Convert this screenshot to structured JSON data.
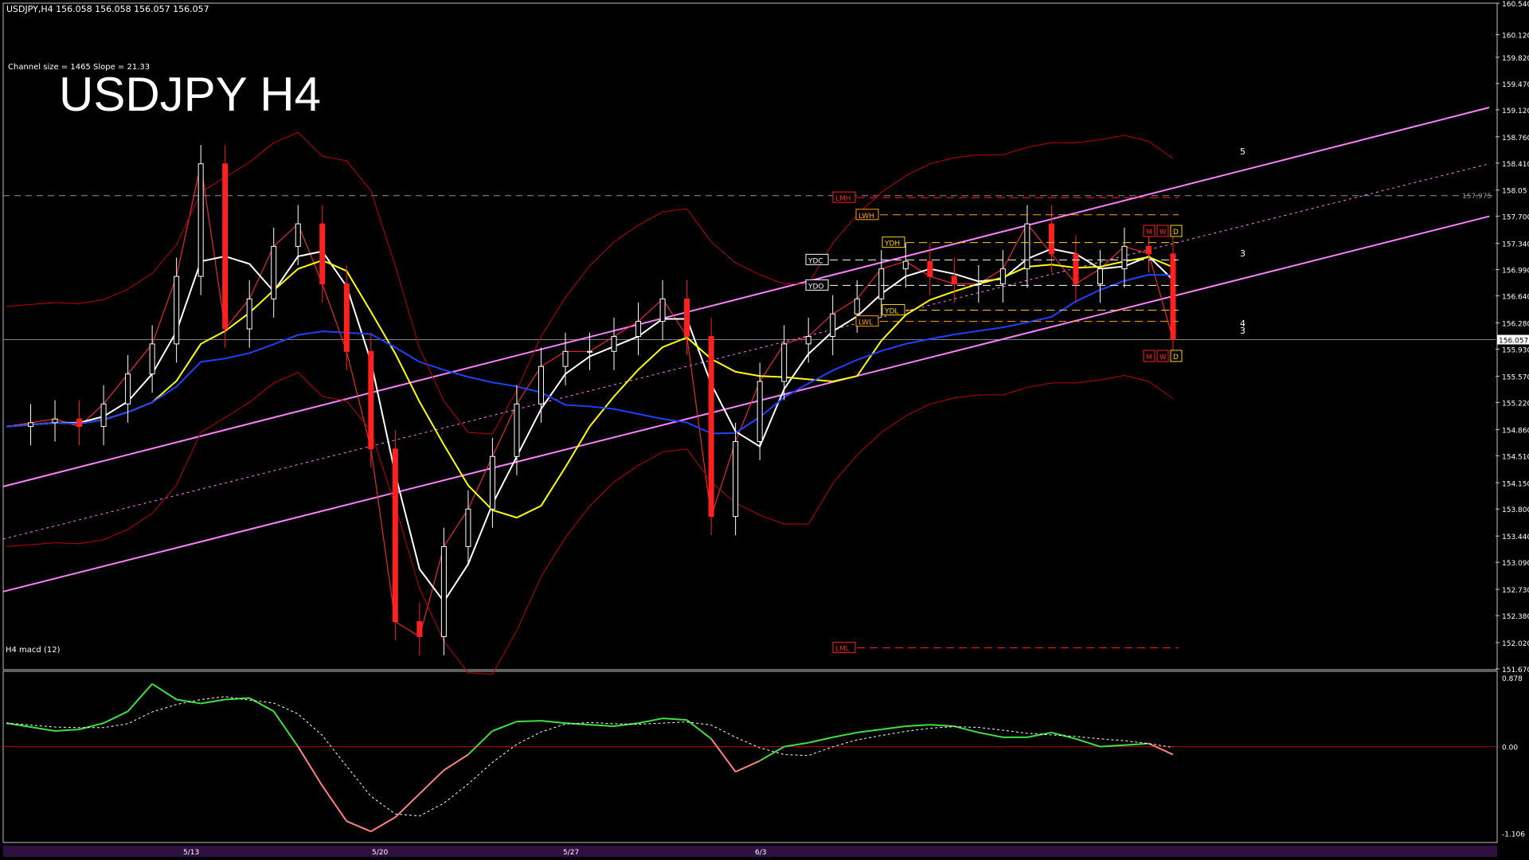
{
  "header": {
    "symbol_line": "USDJPY,H4  156.058 156.058 156.057 156.057",
    "channel_info": "Channel size = 1465 Slope = 21.33",
    "big_title": "USDJPY H4",
    "macd_title": "H4  macd (12)"
  },
  "colors": {
    "background": "#000000",
    "bull_candle": "#ffffff",
    "bear_candle": "#ff2020",
    "channel": "#ff80ff",
    "ma_white": "#ffffff",
    "ma_yellow": "#ffff00",
    "ma_blue": "#2040ff",
    "bollinger": "#c00000",
    "rsi_green": "#20c020",
    "macd_line": "#40e040",
    "macd_line_neg": "#ff8080",
    "macd_signal": "#ffffff",
    "zero_line": "#c00000",
    "axis_text": "#ffffff"
  },
  "chart_data": [
    {
      "type": "line",
      "title": "USDJPY H4",
      "price_scale": [
        "160.540",
        "160.120",
        "159.820",
        "159.470",
        "159.120",
        "158.760",
        "158.410",
        "158.05",
        "157.700",
        "157.340",
        "156.990",
        "156.640",
        "156.280",
        "155.930",
        "155.570",
        "155.220",
        "154.860",
        "154.510",
        "154.150",
        "153.800",
        "153.440",
        "153.090",
        "152.730",
        "152.380",
        "152.020",
        "151.670"
      ],
      "ylim": [
        151.67,
        160.54
      ],
      "current_price": "156.057",
      "dashed_level_label": "157.975",
      "x_date_labels": [
        "5/13",
        "5/20",
        "5/27",
        "6/3"
      ],
      "level_labels": [
        "LMH",
        "LWH",
        "YDH",
        "YDC",
        "YDO",
        "YDL",
        "LWL",
        "LML"
      ],
      "marker_labels": [
        "M",
        "W",
        "D"
      ],
      "wave_labels": [
        "5",
        "3",
        "4",
        "3"
      ],
      "series": [
        {
          "name": "",
          "x": [
            0,
            5,
            10,
            15,
            20,
            25,
            30,
            35,
            40,
            45,
            50,
            55,
            60,
            65,
            70,
            75,
            80,
            85,
            90,
            95,
            100,
            105,
            110,
            115,
            120,
            125,
            130,
            135,
            140,
            145,
            150,
            155,
            160,
            165,
            170,
            175,
            180,
            185,
            190,
            195,
            200,
            205,
            210,
            215,
            220,
            225,
            230,
            235,
            240
          ],
          "values": [
            154.9,
            154.95,
            155.0,
            154.9,
            155.2,
            155.6,
            156.0,
            156.9,
            158.4,
            156.2,
            156.6,
            157.3,
            157.6,
            156.8,
            155.9,
            154.6,
            152.3,
            152.1,
            153.3,
            153.8,
            154.5,
            155.2,
            155.7,
            155.9,
            155.9,
            156.1,
            156.3,
            156.6,
            156.1,
            153.7,
            154.7,
            155.5,
            156.0,
            156.1,
            156.4,
            156.6,
            157.0,
            157.1,
            156.9,
            156.8,
            156.8,
            157.0,
            157.6,
            157.2,
            156.8,
            157.0,
            157.3,
            157.2,
            156.06
          ]
        }
      ]
    },
    {
      "type": "line",
      "title": "H4  macd (12)",
      "price_scale": [
        "0.878",
        "0.00",
        "-1.106"
      ],
      "ylim": [
        -1.2,
        0.95
      ],
      "series": [
        {
          "name": "",
          "x": [
            0,
            5,
            10,
            15,
            20,
            25,
            30,
            35,
            40,
            45,
            50,
            55,
            60,
            65,
            70,
            75,
            80,
            85,
            90,
            95,
            100,
            105,
            110,
            115,
            120,
            125,
            130,
            135,
            140,
            145,
            150,
            155,
            160,
            165,
            170,
            175,
            180,
            185,
            190,
            195,
            200,
            205,
            210,
            215,
            220,
            225,
            230,
            235,
            240
          ],
          "values": [
            0.3,
            0.25,
            0.2,
            0.22,
            0.3,
            0.45,
            0.8,
            0.6,
            0.55,
            0.6,
            0.62,
            0.45,
            0.0,
            -0.5,
            -0.95,
            -1.08,
            -0.9,
            -0.6,
            -0.3,
            -0.1,
            0.2,
            0.32,
            0.33,
            0.3,
            0.28,
            0.26,
            0.3,
            0.36,
            0.34,
            0.1,
            -0.32,
            -0.18,
            0.0,
            0.05,
            0.12,
            0.18,
            0.22,
            0.26,
            0.28,
            0.26,
            0.18,
            0.12,
            0.12,
            0.18,
            0.1,
            0.0,
            0.02,
            0.04,
            -0.1
          ]
        }
      ]
    }
  ]
}
